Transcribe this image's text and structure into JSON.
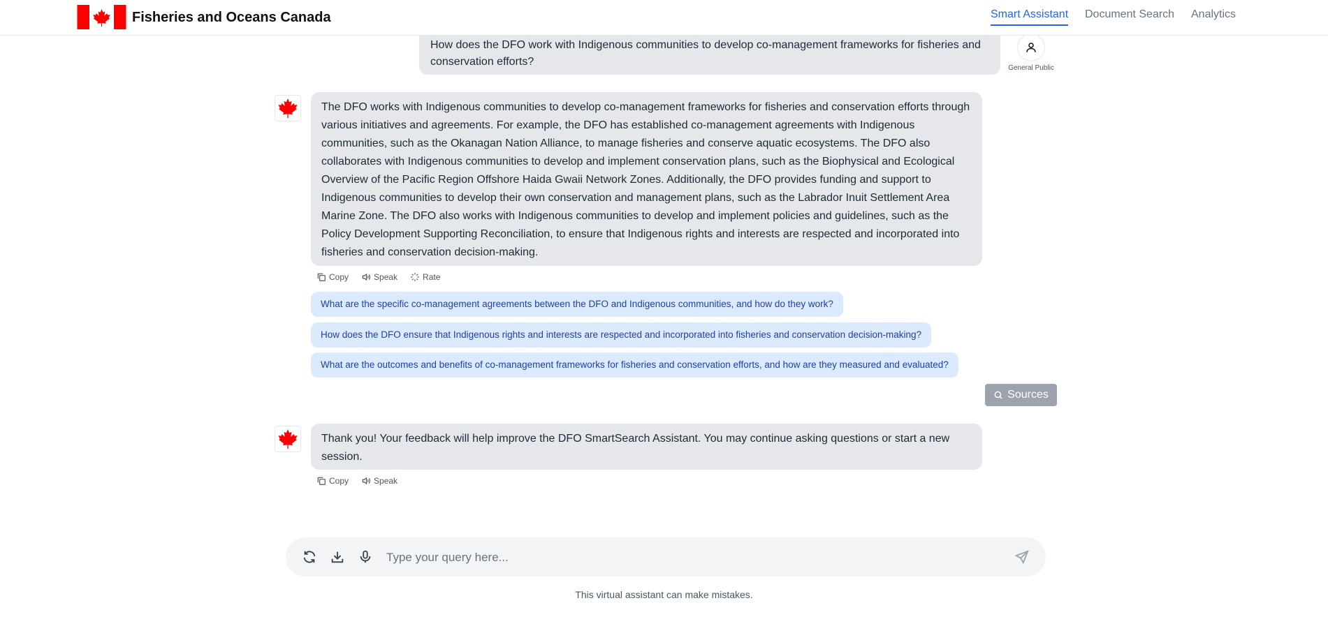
{
  "header": {
    "brand": "Fisheries and Oceans Canada",
    "nav": [
      {
        "label": "Smart Assistant",
        "active": true
      },
      {
        "label": "Document Search",
        "active": false
      },
      {
        "label": "Analytics",
        "active": false
      }
    ]
  },
  "user_message": {
    "text": "How does the DFO work with Indigenous communities to develop co-management frameworks for fisheries and conservation efforts?",
    "role": "General Public",
    "avatar_icon": "user-icon"
  },
  "bot_messages": [
    {
      "text": "The DFO works with Indigenous communities to develop co-management frameworks for fisheries and conservation efforts through various initiatives and agreements. For example, the DFO has established co-management agreements with Indigenous communities, such as the Okanagan Nation Alliance, to manage fisheries and conserve aquatic ecosystems. The DFO also collaborates with Indigenous communities to develop and implement conservation plans, such as the Biophysical and Ecological Overview of the Pacific Region Offshore Haida Gwaii Network Zones. Additionally, the DFO provides funding and support to Indigenous communities to develop their own conservation and management plans, such as the Labrador Inuit Settlement Area Marine Zone. The DFO also works with Indigenous communities to develop and implement policies and guidelines, such as the Policy Development Supporting Reconciliation, to ensure that Indigenous rights and interests are respected and incorporated into fisheries and conservation decision-making.",
      "actions": {
        "copy": "Copy",
        "speak": "Speak",
        "rate": "Rate"
      }
    },
    {
      "text": "Thank you! Your feedback will help improve the DFO SmartSearch Assistant. You may continue asking questions or start a new session.",
      "actions": {
        "copy": "Copy",
        "speak": "Speak"
      }
    }
  ],
  "followups": [
    "What are the specific co-management agreements between the DFO and Indigenous communities, and how do they work?",
    "How does the DFO ensure that Indigenous rights and interests are respected and incorporated into fisheries and conservation decision-making?",
    "What are the outcomes and benefits of co-management frameworks for fisheries and conservation efforts, and how are they measured and evaluated?"
  ],
  "sources_label": "Sources",
  "input": {
    "placeholder": "Type your query here...",
    "value": ""
  },
  "disclaimer": "This virtual assistant can make mistakes.",
  "colors": {
    "flag_red": "#ff0000",
    "accent_blue": "#2563eb",
    "followup_bg": "#dbeafe",
    "followup_text": "#1e40af",
    "bubble_bg": "#e5e7eb",
    "sources_bg": "#9ca3af"
  }
}
